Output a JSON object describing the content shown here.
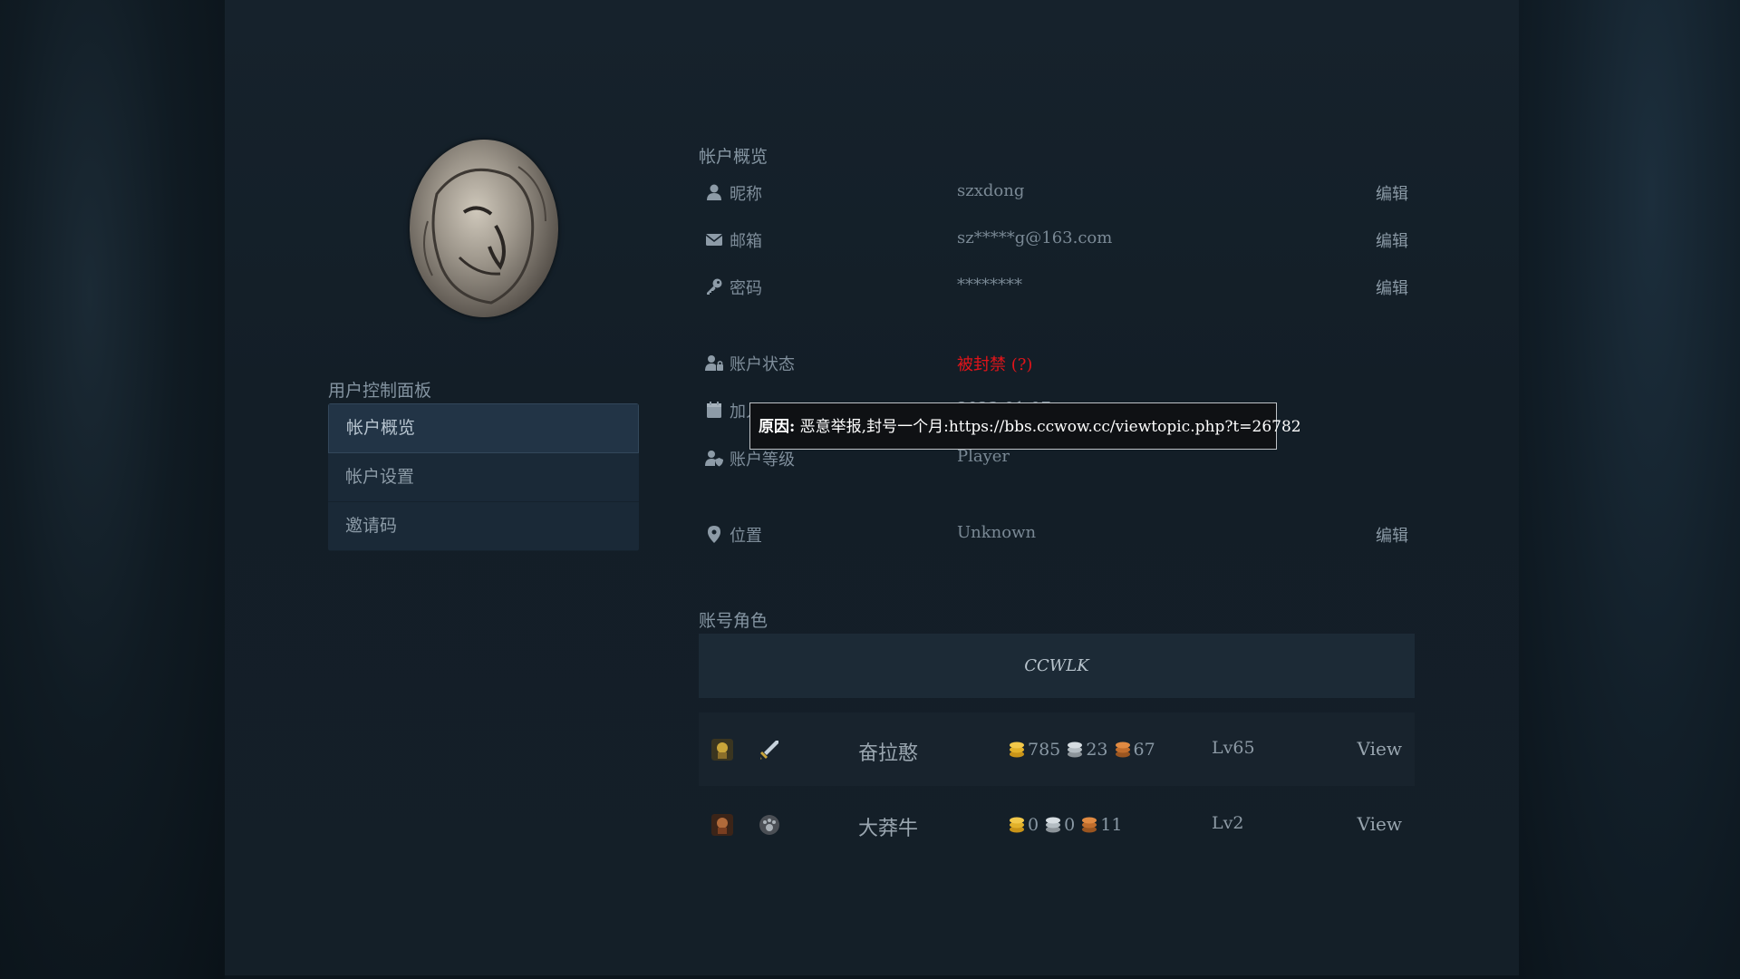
{
  "sidebar": {
    "title": "用户控制面板",
    "items": [
      {
        "label": "帐户概览"
      },
      {
        "label": "帐户设置"
      },
      {
        "label": "邀请码"
      }
    ]
  },
  "overview": {
    "title": "帐户概览",
    "nickname": {
      "label": "昵称",
      "value": "szxdong",
      "edit": "编辑"
    },
    "email": {
      "label": "邮箱",
      "value": "sz*****g@163.com",
      "edit": "编辑"
    },
    "password": {
      "label": "密码",
      "value": "********",
      "edit": "编辑"
    },
    "status": {
      "label": "账户状态",
      "value": "被封禁 (?)"
    },
    "joined": {
      "label": "加入时间",
      "value": "2023-01-07"
    },
    "rank": {
      "label": "账户等级",
      "value": "Player"
    },
    "location": {
      "label": "位置",
      "value": "Unknown",
      "edit": "编辑"
    }
  },
  "tooltip": {
    "label": "原因:",
    "text": " 恶意举报,封号一个月:https://bbs.ccwow.cc/viewtopic.php?t=26782"
  },
  "characters": {
    "title": "账号角色",
    "realm": "CCWLK",
    "rows": [
      {
        "name": "奋拉憨",
        "gold": "785",
        "silver": "23",
        "copper": "67",
        "level": "Lv65",
        "view": "View"
      },
      {
        "name": "大莽牛",
        "gold": "0",
        "silver": "0",
        "copper": "11",
        "level": "Lv2",
        "view": "View"
      }
    ]
  },
  "colors": {
    "danger": "#e0141a",
    "panel": "#16222c",
    "accent": "#223446"
  }
}
